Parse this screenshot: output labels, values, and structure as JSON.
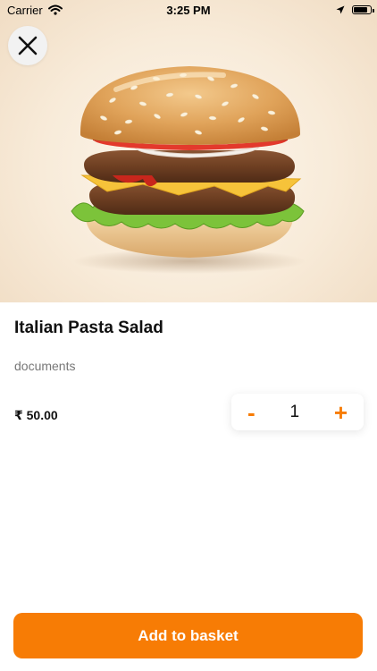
{
  "status_bar": {
    "carrier": "Carrier",
    "time": "3:25 PM",
    "battery_level": 0.85
  },
  "hero": {
    "image_icon": "burger-image",
    "close_icon": "close-icon"
  },
  "product": {
    "name": "Italian Pasta Salad",
    "description": "documents",
    "price": "₹ 50.00"
  },
  "stepper": {
    "minus_label": "-",
    "quantity": "1",
    "plus_label": "+"
  },
  "actions": {
    "add_to_basket_label": "Add to basket"
  },
  "colors": {
    "accent": "#f77c05",
    "hero_bg": "#f8ebd9"
  }
}
